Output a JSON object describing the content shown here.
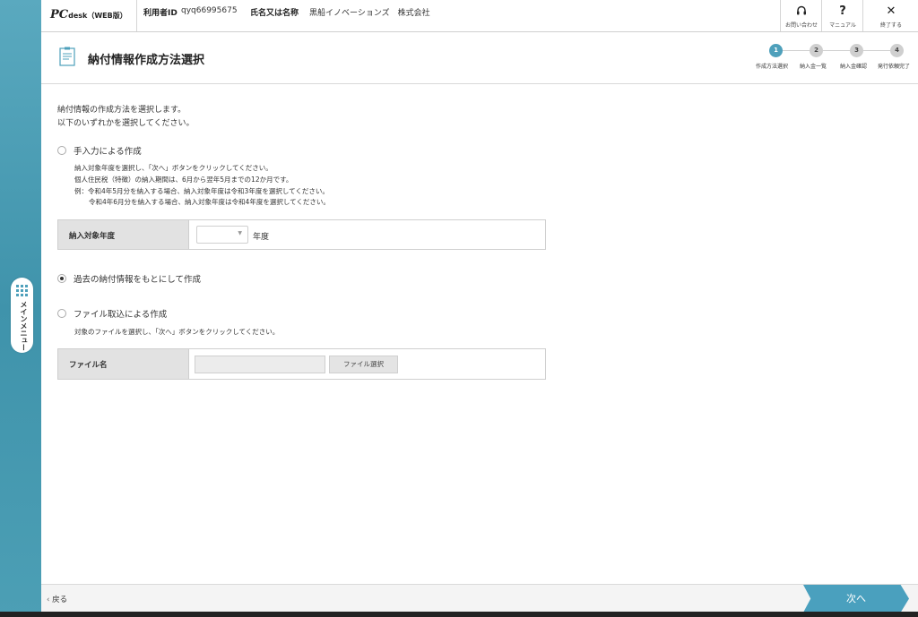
{
  "header": {
    "logo_main": "PC",
    "logo_rest": "desk（WEB版）",
    "user_id_label": "利用者ID",
    "user_id_value": "qyq66995675",
    "name_label": "氏名又は名称",
    "name_value": "黒船イノベーションズ　株式会社",
    "contact_label": "お問い合わせ",
    "manual_label": "マニュアル",
    "manual_glyph": "?",
    "exit_label": "終了する",
    "exit_glyph": "✕"
  },
  "sidebar": {
    "menu_label": "メインメニュー"
  },
  "page": {
    "title": "納付情報作成方法選択"
  },
  "steps": [
    {
      "num": "1",
      "label": "作成方法選択"
    },
    {
      "num": "2",
      "label": "納入金一覧"
    },
    {
      "num": "3",
      "label": "納入金確認"
    },
    {
      "num": "4",
      "label": "発行依頼完了"
    }
  ],
  "intro": {
    "line1": "納付情報の作成方法を選択します。",
    "line2": "以下のいずれかを選択してください。"
  },
  "option_manual": {
    "label": "手入力による作成",
    "desc1": "納入対象年度を選択し、「次へ」ボタンをクリックしてください。",
    "desc2": "個人住民税（特徴）の納入期間は、6月から翌年5月までの12か月です。",
    "desc3": "例：令和4年5月分を納入する場合、納入対象年度は令和3年度を選択してください。",
    "desc4": "令和4年6月分を納入する場合、納入対象年度は令和4年度を選択してください。",
    "field_label": "納入対象年度",
    "year_value": "",
    "year_unit": "年度"
  },
  "option_past": {
    "label": "過去の納付情報をもとにして作成"
  },
  "option_file": {
    "label": "ファイル取込による作成",
    "desc": "対象のファイルを選択し、「次へ」ボタンをクリックしてください。",
    "field_label": "ファイル名",
    "button_label": "ファイル選択"
  },
  "footer": {
    "back_label": "戻る",
    "next_label": "次へ"
  }
}
